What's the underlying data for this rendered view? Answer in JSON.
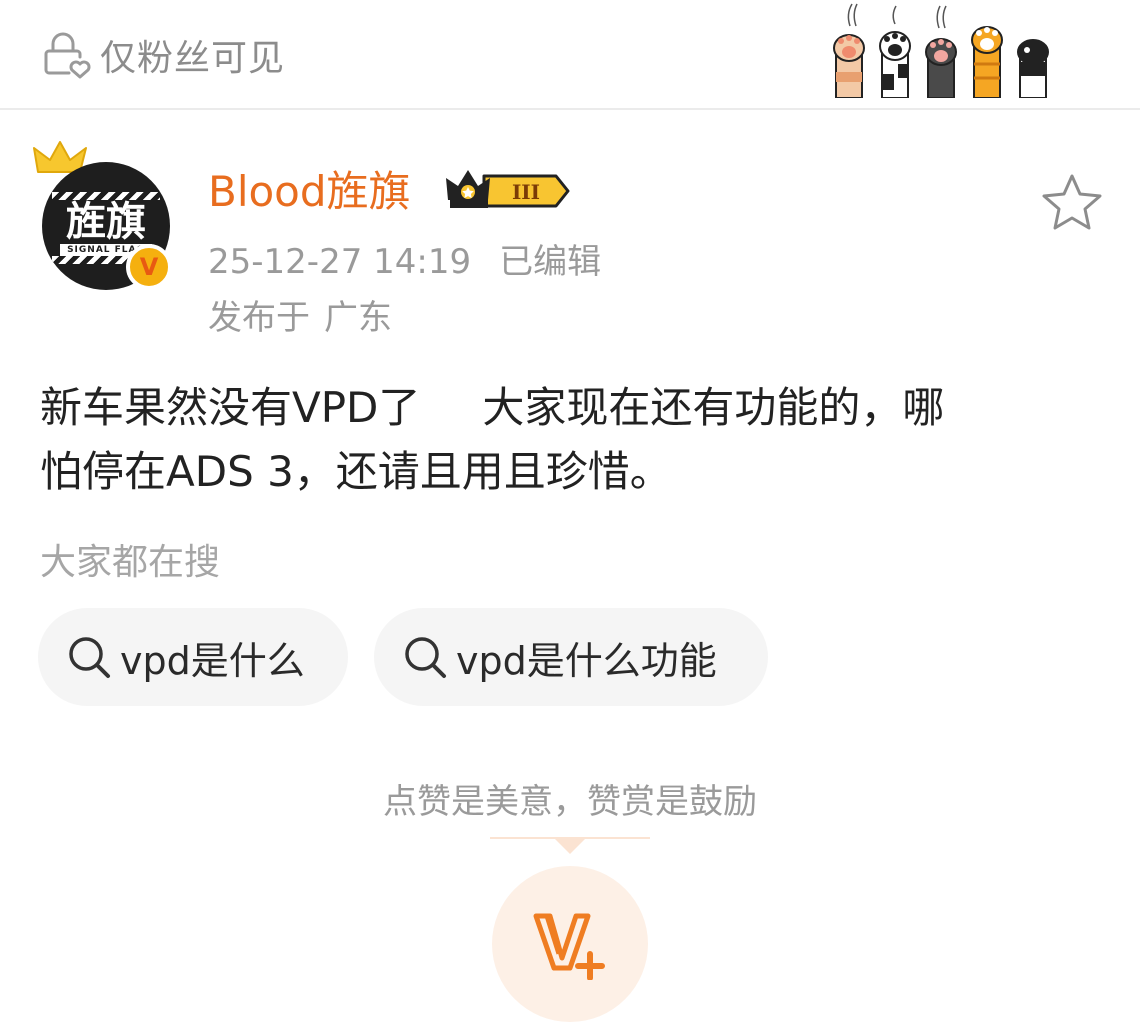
{
  "header": {
    "visibility_label": "仅粉丝可见",
    "decoration": "cat-paws-sticker"
  },
  "post": {
    "author": {
      "name": "Blood旌旗",
      "avatar_text": "旌旗",
      "avatar_subtext": "SIGNAL FLAG",
      "verified_mark": "V",
      "member_level": "III"
    },
    "timestamp": "25-12-27 14:19",
    "edited_label": "已编辑",
    "location_prefix": "发布于",
    "location": "广东",
    "text_line1_a": "新车果然没有VPD了",
    "text_line1_b": "大家现在还有功能的，哪",
    "text_line2": "怕停在ADS 3，还请且用且珍惜。"
  },
  "search": {
    "title": "大家都在搜",
    "chips": [
      {
        "label": "vpd是什么",
        "icon": "search-icon"
      },
      {
        "label": "vpd是什么功能",
        "icon": "search-icon"
      }
    ]
  },
  "reward": {
    "tip": "点赞是美意，赞赏是鼓励",
    "icon": "v-plus-icon"
  },
  "colors": {
    "accent": "#e86d1f",
    "muted_text": "#9a9a9a",
    "chip_bg": "#f5f5f5",
    "reward_bg": "#fdf0e6"
  }
}
